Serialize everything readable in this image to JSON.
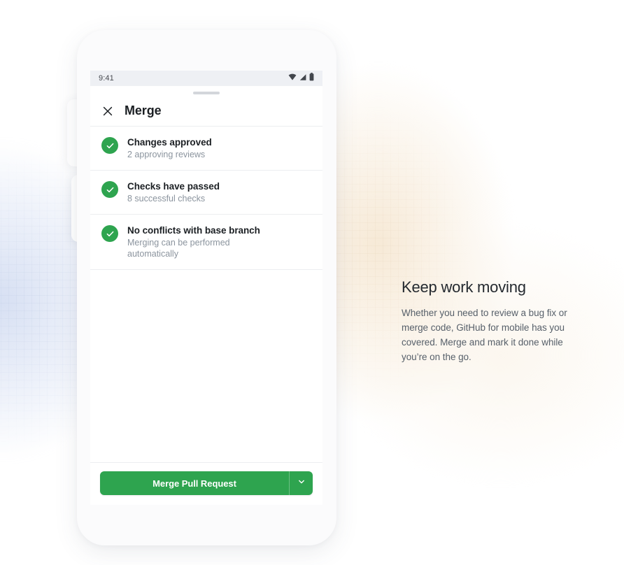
{
  "phone": {
    "status_bar": {
      "time": "9:41",
      "icons": [
        "wifi-icon",
        "cellular-signal-icon",
        "battery-icon"
      ]
    },
    "sheet": {
      "drag_handle": "drag-handle",
      "close_label": "×",
      "title": "Merge",
      "checks": [
        {
          "icon": "check-circle-icon",
          "title": "Changes approved",
          "subtitle": "2 approving reviews"
        },
        {
          "icon": "check-circle-icon",
          "title": "Checks have passed",
          "subtitle": "8 successful checks"
        },
        {
          "icon": "check-circle-icon",
          "title": "No conflicts with base branch",
          "subtitle": "Merging can be performed automatically"
        }
      ],
      "footer": {
        "primary_label": "Merge Pull Request",
        "dropdown_icon": "chevron-down-icon"
      }
    }
  },
  "copy": {
    "heading": "Keep work moving",
    "body": "Whether you need to review a bug fix or merge code, GitHub for mobile has you covered. Merge and mark it done while you’re on the go."
  },
  "colors": {
    "green": "#2ea44f",
    "heading": "#24292f",
    "body_text": "#57606a",
    "muted": "#8b949e",
    "status_bar_bg": "#eef0f4"
  }
}
